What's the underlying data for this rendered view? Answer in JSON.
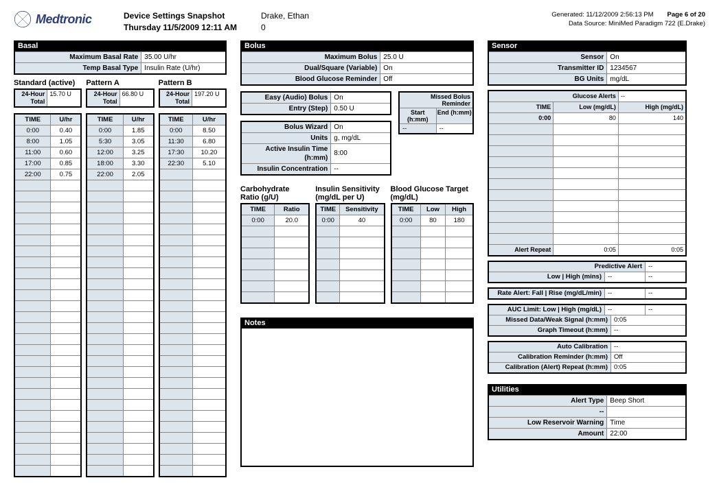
{
  "header": {
    "brand": "Medtronic",
    "title": "Device Settings Snapshot",
    "timestamp": "Thursday 11/5/2009 12:11 AM",
    "patient": "Drake, Ethan",
    "patient_sub": "0",
    "generated": "Generated: 11/12/2009 2:56:13 PM",
    "page": "Page 6 of 20",
    "source": "Data Source: MiniMed Paradigm 722 (E.Drake)"
  },
  "basal": {
    "section": "Basal",
    "max_rate_label": "Maximum Basal Rate",
    "max_rate": "35.00 U/hr",
    "temp_label": "Temp Basal Type",
    "temp": "Insulin Rate (U/hr)",
    "patterns": [
      {
        "name": "Standard (active)",
        "total_label": "24-Hour Total",
        "total": "15.70 U",
        "h_time": "TIME",
        "h_val": "U/hr",
        "rows": [
          [
            "0:00",
            "0.40"
          ],
          [
            "8:00",
            "1.05"
          ],
          [
            "11:00",
            "0.60"
          ],
          [
            "17:00",
            "0.85"
          ],
          [
            "22:00",
            "0.75"
          ]
        ]
      },
      {
        "name": "Pattern A",
        "total_label": "24-Hour Total",
        "total": "66.80 U",
        "h_time": "TIME",
        "h_val": "U/hr",
        "rows": [
          [
            "0:00",
            "1.85"
          ],
          [
            "5:30",
            "3.05"
          ],
          [
            "12:00",
            "3.25"
          ],
          [
            "18:00",
            "3.30"
          ],
          [
            "22:00",
            "2.05"
          ]
        ]
      },
      {
        "name": "Pattern B",
        "total_label": "24-Hour Total",
        "total": "197.20 U",
        "h_time": "TIME",
        "h_val": "U/hr",
        "rows": [
          [
            "0:00",
            "8.50"
          ],
          [
            "11:30",
            "6.80"
          ],
          [
            "17:30",
            "10.20"
          ],
          [
            "22:30",
            "5.10"
          ]
        ]
      }
    ]
  },
  "bolus": {
    "section": "Bolus",
    "r1k": "Maximum Bolus",
    "r1v": "25.0 U",
    "r2k": "Dual/Square (Variable)",
    "r2v": "On",
    "r3k": "Blood Glucose Reminder",
    "r3v": "Off",
    "easy_k": "Easy (Audio) Bolus",
    "easy_v": "On",
    "step_k": "Entry (Step)",
    "step_v": "0.50 U",
    "wiz_k": "Bolus Wizard",
    "wiz_v": "On",
    "units_k": "Units",
    "units_v": "g, mg/dL",
    "ait_k": "Active Insulin Time (h:mm)",
    "ait_v": "8:00",
    "conc_k": "Insulin Concentration",
    "conc_v": "--",
    "missed_k": "Missed Bolus Reminder",
    "missed_start": "Start (h:mm)",
    "missed_end": "End (h:mm)",
    "missed_sv": "--",
    "missed_ev": "--",
    "carb_title": "Carbohydrate Ratio (g/U)",
    "carb_h1": "TIME",
    "carb_h2": "Ratio",
    "carb_rows": [
      [
        "0:00",
        "20.0"
      ]
    ],
    "sens_title": "Insulin Sensitivity (mg/dL per U)",
    "sens_h1": "TIME",
    "sens_h2": "Sensitivity",
    "sens_rows": [
      [
        "0:00",
        "40"
      ]
    ],
    "bgt_title": "Blood Glucose Target (mg/dL)",
    "bgt_h1": "TIME",
    "bgt_h2": "Low",
    "bgt_h3": "High",
    "bgt_rows": [
      [
        "0:00",
        "80",
        "180"
      ]
    ]
  },
  "notes": {
    "section": "Notes"
  },
  "sensor": {
    "section": "Sensor",
    "r1k": "Sensor",
    "r1v": "On",
    "r2k": "Transmitter ID",
    "r2v": "1234567",
    "r3k": "BG Units",
    "r3v": "mg/dL",
    "ga_k": "Glucose Alerts",
    "ga_v": "--",
    "gt_h1": "TIME",
    "gt_h2": "Low (mg/dL)",
    "gt_h3": "High (mg/dL)",
    "gt_rows": [
      [
        "0:00",
        "80",
        "140"
      ]
    ],
    "ar_k": "Alert Repeat",
    "ar_v1": "0:05",
    "ar_v2": "0:05",
    "pa_k": "Predictive Alert",
    "pa_v": "--",
    "lh_k": "Low | High (mins)",
    "lh_v1": "--",
    "lh_v2": "--",
    "ra_k": "Rate Alert: Fall | Rise (mg/dL/min)",
    "ra_v1": "--",
    "ra_v2": "--",
    "auc_k": "AUC Limit: Low | High (mg/dL)",
    "auc_v1": "--",
    "auc_v2": "--",
    "mw_k": "Missed Data/Weak Signal (h:mm)",
    "mw_v": "0:05",
    "gt_k": "Graph Timeout (h:mm)",
    "gt_v": "--",
    "ac_k": "Auto Calibration",
    "ac_v": "--",
    "cr_k": "Calibration Reminder (h:mm)",
    "cr_v": "Off",
    "car_k": "Calibration (Alert) Repeat (h:mm)",
    "car_v": "0:05"
  },
  "utilities": {
    "section": "Utilities",
    "r1k": "Alert Type",
    "r1v": "Beep Short",
    "r2k": "--",
    "r2v": "",
    "r3k": "Low Reservoir Warning",
    "r3v": "Time",
    "r4k": "Amount",
    "r4v": "22:00"
  }
}
